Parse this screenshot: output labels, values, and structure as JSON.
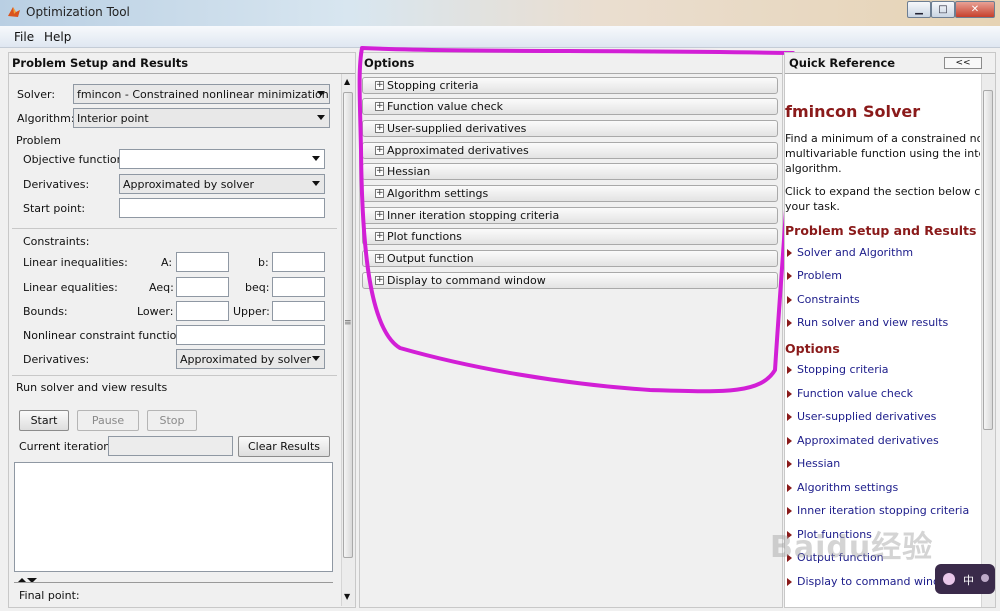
{
  "window": {
    "title": "Optimization Tool",
    "minimize": "▁",
    "maximize": "□",
    "close": "✕"
  },
  "menu": [
    "File",
    "Help"
  ],
  "left": {
    "title": "Problem Setup and Results",
    "solver_label": "Solver:",
    "solver_value": "fmincon - Constrained nonlinear minimization",
    "algorithm_label": "Algorithm:",
    "algorithm_value": "Interior point",
    "problem_group": "Problem",
    "objective_label": "Objective function:",
    "objective_value": "",
    "derivatives_label": "Derivatives:",
    "derivatives_value": "Approximated by solver",
    "start_label": "Start point:",
    "constraints_group": "Constraints:",
    "lin_ineq_label": "Linear inequalities:",
    "a_label": "A:",
    "b_label": "b:",
    "lin_eq_label": "Linear equalities:",
    "aeq_label": "Aeq:",
    "beq_label": "beq:",
    "bounds_label": "Bounds:",
    "lower_label": "Lower:",
    "upper_label": "Upper:",
    "nonlin_label": "Nonlinear constraint function:",
    "derivatives2_label": "Derivatives:",
    "derivatives2_value": "Approximated by solver",
    "run_group": "Run solver and view results",
    "start_btn": "Start",
    "pause_btn": "Pause",
    "stop_btn": "Stop",
    "iteration_label": "Current iteration:",
    "clear_btn": "Clear Results",
    "final_point_label": "Final point:"
  },
  "options": {
    "title": "Options",
    "items": [
      "Stopping criteria",
      "Function value check",
      "User-supplied derivatives",
      "Approximated derivatives",
      "Hessian",
      "Algorithm settings",
      "Inner iteration stopping criteria",
      "Plot functions",
      "Output function",
      "Display to command window"
    ]
  },
  "quickref": {
    "title": "Quick Reference",
    "collapse": "<<",
    "heading": "fmincon Solver",
    "desc": [
      "Find a minimum of a constrained nonline",
      "multivariable function using the interior-p",
      "algorithm."
    ],
    "click": [
      "Click to expand the section below corres",
      "your task."
    ],
    "setup_heading": "Problem Setup and Results",
    "setup_links": [
      "Solver and Algorithm",
      "Problem",
      "Constraints",
      "Run solver and view results"
    ],
    "options_heading": "Options",
    "option_links": [
      "Stopping criteria",
      "Function value check",
      "User-supplied derivatives",
      "Approximated derivatives",
      "Hessian",
      "Algorithm settings",
      "Inner iteration stopping criteria",
      "Plot functions",
      "Output function",
      "Display to command window"
    ]
  },
  "watermark": "Baidu经验",
  "colors": {
    "annotation": "#d21fd6"
  }
}
